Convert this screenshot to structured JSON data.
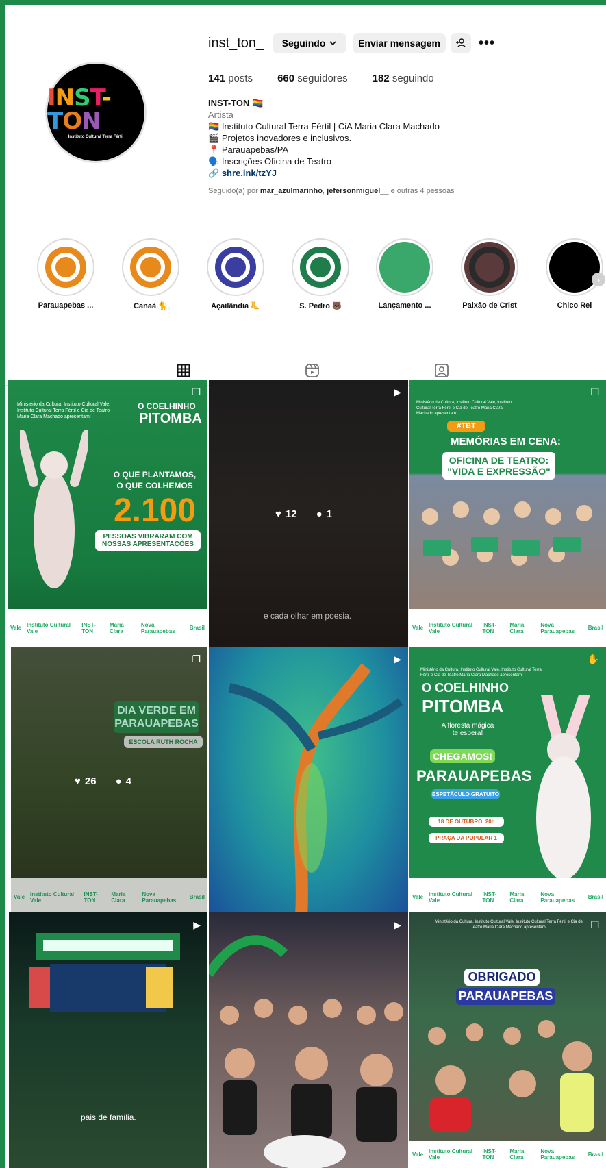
{
  "profile": {
    "username": "inst_ton_",
    "follow_label": "Seguindo",
    "message_label": "Enviar mensagem",
    "more_icon": "more-icon",
    "posts_count": "141",
    "posts_label": "posts",
    "followers_count": "660",
    "followers_label": "seguidores",
    "following_count": "182",
    "following_label": "seguindo",
    "avatar_logo_text": "INST-TON",
    "avatar_logo_sub": "Instituto Cultural Terra Fértil"
  },
  "bio": {
    "name": "INST-TON",
    "category": "Artista",
    "lines": [
      "Instituto Cultural Terra Fértil | CiA Maria Clara Machado",
      "Projetos inovadores e inclusivos.",
      "Parauapebas/PA",
      "Inscrições Oficina de Teatro"
    ],
    "link": "shre.ink/tzYJ",
    "followed_prefix": "Seguido(a) por",
    "followed_user1": "mar_azulmarinho",
    "followed_user2": "jefersonmiguel__",
    "followed_suffix": "e outras 4 pessoas"
  },
  "highlights": [
    {
      "label": "Parauapebas ...",
      "ring": "#e8891c",
      "core": "#e8891c"
    },
    {
      "label": "Canaã 🐈",
      "ring": "#e8891c",
      "core": "#e8891c"
    },
    {
      "label": "Açailândia 🦶",
      "ring": "#3a3ea0",
      "core": "#3a3ea0"
    },
    {
      "label": "S. Pedro 🐻",
      "ring": "#1e7d4a",
      "core": "#1e7d4a"
    },
    {
      "label": "Lançamento ...",
      "ring": "#3aa86b",
      "core": "#3aa86b"
    },
    {
      "label": "Paixão de Crist",
      "ring": "#2a2a2a",
      "core": "#5a3a3a"
    },
    {
      "label": "Chico Rei",
      "ring": "#000000",
      "core": "#000000"
    }
  ],
  "posts": {
    "p1": {
      "credits": "Ministério da Cultura, Instituto Cultural Vale, Instituto Cultural Terra Fértil e Cia de Teatro Maria Clara Machado apresentam:",
      "title1": "O COELHINHO",
      "title2": "PITOMBA",
      "line1": "O QUE PLANTAMOS,",
      "line2": "O QUE COLHEMOS",
      "number": "2.100",
      "sub": "PESSOAS VIBRARAM COM NOSSAS APRESENTAÇÕES"
    },
    "p2": {
      "likes": "12",
      "comments": "1",
      "caption": "e cada olhar em poesia."
    },
    "p3": {
      "credits": "Ministério da Cultura, Instituto Cultural Vale, Instituto Cultural Terra Fértil e Cia de Teatro Maria Clara Machado apresentam:",
      "tag": "#TBT",
      "title": "MEMÓRIAS EM CENA:",
      "line1": "OFICINA DE TEATRO:",
      "line2": "\"VIDA E EXPRESSÃO\""
    },
    "p4": {
      "title1": "DIA VERDE EM",
      "title2": "PARAUAPEBAS",
      "sub": "ESCOLA RUTH ROCHA",
      "likes": "26",
      "comments": "4"
    },
    "p6": {
      "credits": "Ministério da Cultura, Instituto Cultural Vale, Instituto Cultural Terra Fértil e Cia de Teatro Maria Clara Machado apresentam:",
      "title1": "O COELHINHO",
      "title2": "PITOMBA",
      "tagline": "A floresta mágica te espera!",
      "badge": "CHEGAMOS!",
      "city": "PARAUAPEBAS",
      "free": "ESPETÁCULO GRATUITO",
      "date": "18 DE OUTUBRO, 20h",
      "place": "PRAÇA DA POPULAR 1"
    },
    "p7": {
      "caption": "pais de família."
    },
    "p9": {
      "credits": "Ministério da Cultura, Instituto Cultural Vale, Instituto Cultural Terra Fértil e Cia de Teatro Maria Clara Machado apresentam:",
      "line1": "OBRIGADO",
      "line2": "PARAUAPEBAS"
    },
    "sponsors": [
      "Vale",
      "Instituto Cultural Vale",
      "INST-TON",
      "Maria Clara",
      "Nova Parauapebas",
      "Brasil"
    ]
  }
}
